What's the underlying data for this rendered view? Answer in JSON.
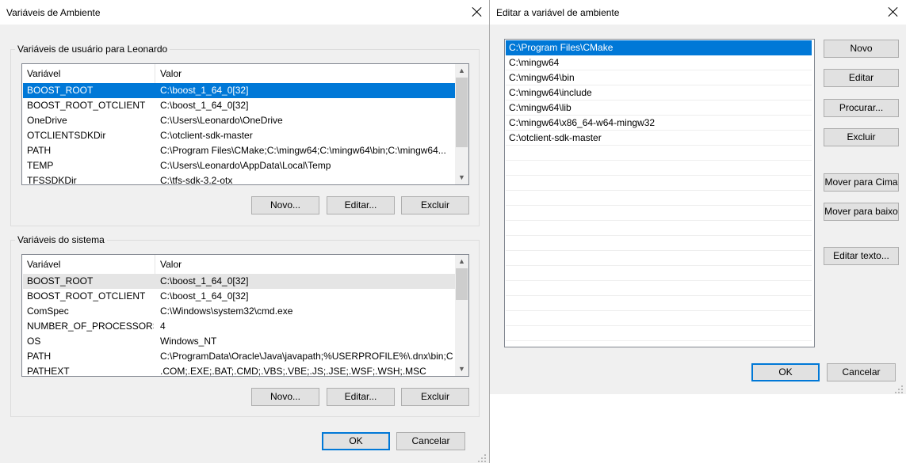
{
  "env_dialog": {
    "title": "Variáveis de Ambiente",
    "user_group_label": "Variáveis de usuário para Leonardo",
    "system_group_label": "Variáveis do sistema",
    "col_variable": "Variável",
    "col_value": "Valor",
    "user_vars": [
      {
        "name": "BOOST_ROOT",
        "value": "C:\\boost_1_64_0[32]"
      },
      {
        "name": "BOOST_ROOT_OTCLIENT",
        "value": "C:\\boost_1_64_0[32]"
      },
      {
        "name": "OneDrive",
        "value": "C:\\Users\\Leonardo\\OneDrive"
      },
      {
        "name": "OTCLIENTSDKDir",
        "value": "C:\\otclient-sdk-master"
      },
      {
        "name": "PATH",
        "value": "C:\\Program Files\\CMake;C:\\mingw64;C:\\mingw64\\bin;C:\\mingw64..."
      },
      {
        "name": "TEMP",
        "value": "C:\\Users\\Leonardo\\AppData\\Local\\Temp"
      },
      {
        "name": "TFSSDKDir",
        "value": "C:\\tfs-sdk-3.2-otx"
      }
    ],
    "system_vars": [
      {
        "name": "BOOST_ROOT",
        "value": "C:\\boost_1_64_0[32]"
      },
      {
        "name": "BOOST_ROOT_OTCLIENT",
        "value": "C:\\boost_1_64_0[32]"
      },
      {
        "name": "ComSpec",
        "value": "C:\\Windows\\system32\\cmd.exe"
      },
      {
        "name": "NUMBER_OF_PROCESSORS",
        "value": "4"
      },
      {
        "name": "OS",
        "value": "Windows_NT"
      },
      {
        "name": "PATH",
        "value": "C:\\ProgramData\\Oracle\\Java\\javapath;%USERPROFILE%\\.dnx\\bin;C..."
      },
      {
        "name": "PATHEXT",
        "value": ".COM;.EXE;.BAT;.CMD;.VBS;.VBE;.JS;.JSE;.WSF;.WSH;.MSC"
      }
    ],
    "btn_new": "Novo...",
    "btn_edit": "Editar...",
    "btn_delete": "Excluir",
    "btn_ok": "OK",
    "btn_cancel": "Cancelar"
  },
  "edit_dialog": {
    "title": "Editar a variável de ambiente",
    "paths": [
      "C:\\Program Files\\CMake",
      "C:\\mingw64",
      "C:\\mingw64\\bin",
      "C:\\mingw64\\include",
      "C:\\mingw64\\lib",
      "C:\\mingw64\\x86_64-w64-mingw32",
      "C:\\otclient-sdk-master"
    ],
    "btn_new": "Novo",
    "btn_edit": "Editar",
    "btn_browse": "Procurar...",
    "btn_delete": "Excluir",
    "btn_move_up": "Mover para Cima",
    "btn_move_down": "Mover para baixo",
    "btn_edit_text": "Editar texto...",
    "btn_ok": "OK",
    "btn_cancel": "Cancelar"
  },
  "colors": {
    "selection": "#0078d7",
    "dialog_bg": "#f0f0f0",
    "button_bg": "#e1e1e1"
  }
}
